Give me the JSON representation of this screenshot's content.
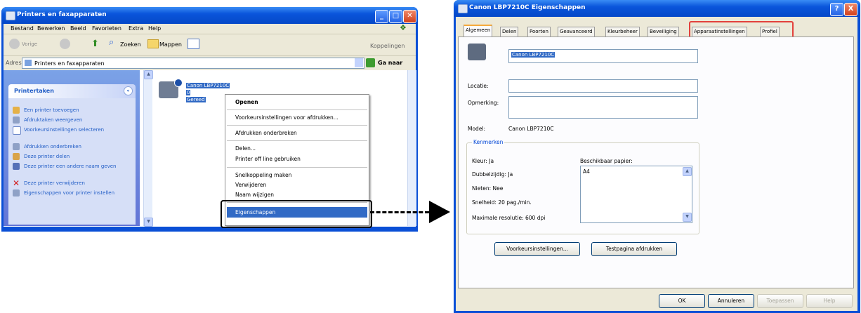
{
  "explorer": {
    "title": "Printers en faxapparaten",
    "menu": [
      "Bestand",
      "Bewerken",
      "Beeld",
      "Favorieten",
      "Extra",
      "Help"
    ],
    "toolbar": {
      "back": "Vorige",
      "search": "Zoeken",
      "folders": "Mappen",
      "links": "Koppelingen"
    },
    "address_label": "Adres",
    "address_value": "Printers en faxapparaten",
    "go_label": "Ga naar",
    "tasks_title": "Printertaken",
    "tasks": [
      "Een printer toevoegen",
      "Afdruktaken weergeven",
      "Voorkeursinstellingen selecteren",
      "Afdrukken onderbreken",
      "Deze printer delen",
      "Deze printer een andere naam geven",
      "Deze printer verwijderen",
      "Eigenschappen voor printer instellen"
    ],
    "printer": {
      "name": "Canon LBP7210C",
      "count": "0",
      "status": "Gereed"
    },
    "context_menu": {
      "items": [
        "Openen",
        "Voorkeursinstellingen voor afdrukken...",
        "Afdrukken onderbreken",
        "Delen...",
        "Printer off line gebruiken",
        "Snelkoppeling maken",
        "Verwijderen",
        "Naam wijzigen",
        "Eigenschappen"
      ]
    }
  },
  "properties": {
    "title": "Canon LBP7210C Eigenschappen",
    "tabs": [
      "Algemeen",
      "Delen",
      "Poorten",
      "Geavanceerd",
      "Kleurbeheer",
      "Beveiliging",
      "Apparaatinstellingen",
      "Profiel"
    ],
    "printer_name": "Canon LBP7210C",
    "location_label": "Locatie:",
    "comment_label": "Opmerking:",
    "model_label": "Model:",
    "model_value": "Canon LBP7210C",
    "features_label": "Kenmerken",
    "color_label": "Kleur: Ja",
    "duplex_label": "Dubbelzijdig: Ja",
    "staple_label": "Nieten: Nee",
    "speed_label": "Snelheid: 20 pag./min.",
    "resolution_label": "Maximale resolutie: 600 dpi",
    "paper_label": "Beschikbaar papier:",
    "paper_items": [
      "A4"
    ],
    "prefs_button": "Voorkeursinstellingen...",
    "testpage_button": "Testpagina afdrukken",
    "ok_button": "OK",
    "cancel_button": "Annuleren",
    "apply_button": "Toepassen",
    "help_button": "Help",
    "help_icon": "?",
    "close_icon": "X"
  }
}
